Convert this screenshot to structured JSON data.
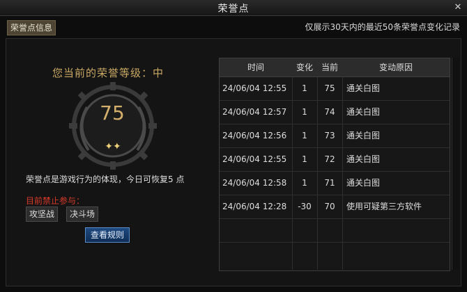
{
  "window": {
    "title": "荣誉点"
  },
  "tab": {
    "label": "荣誉点信息"
  },
  "header_note": "仅展示30天内的最近50条荣誉点变化记录",
  "left": {
    "grade_text": "您当前的荣誉等级：中",
    "score": "75",
    "stars": "✦✦",
    "description": "荣誉点是游戏行为的体现，今日可恢复5 点",
    "banned_label": "目前禁止参与：",
    "modes": [
      "攻坚战",
      "决斗场"
    ],
    "rules_button": "查看规则"
  },
  "table": {
    "headers": [
      "时间",
      "变化",
      "当前",
      "变动原因"
    ],
    "rows": [
      {
        "time": "24/06/04 12:55",
        "change": "1",
        "current": "75",
        "reason": "通关白图"
      },
      {
        "time": "24/06/04 12:57",
        "change": "1",
        "current": "74",
        "reason": "通关白图"
      },
      {
        "time": "24/06/04 12:56",
        "change": "1",
        "current": "73",
        "reason": "通关白图"
      },
      {
        "time": "24/06/04 12:55",
        "change": "1",
        "current": "72",
        "reason": "通关白图"
      },
      {
        "time": "24/06/04 12:58",
        "change": "1",
        "current": "71",
        "reason": "通关白图"
      },
      {
        "time": "24/06/04 12:28",
        "change": "-30",
        "current": "70",
        "reason": "使用可疑第三方软件"
      }
    ]
  }
}
